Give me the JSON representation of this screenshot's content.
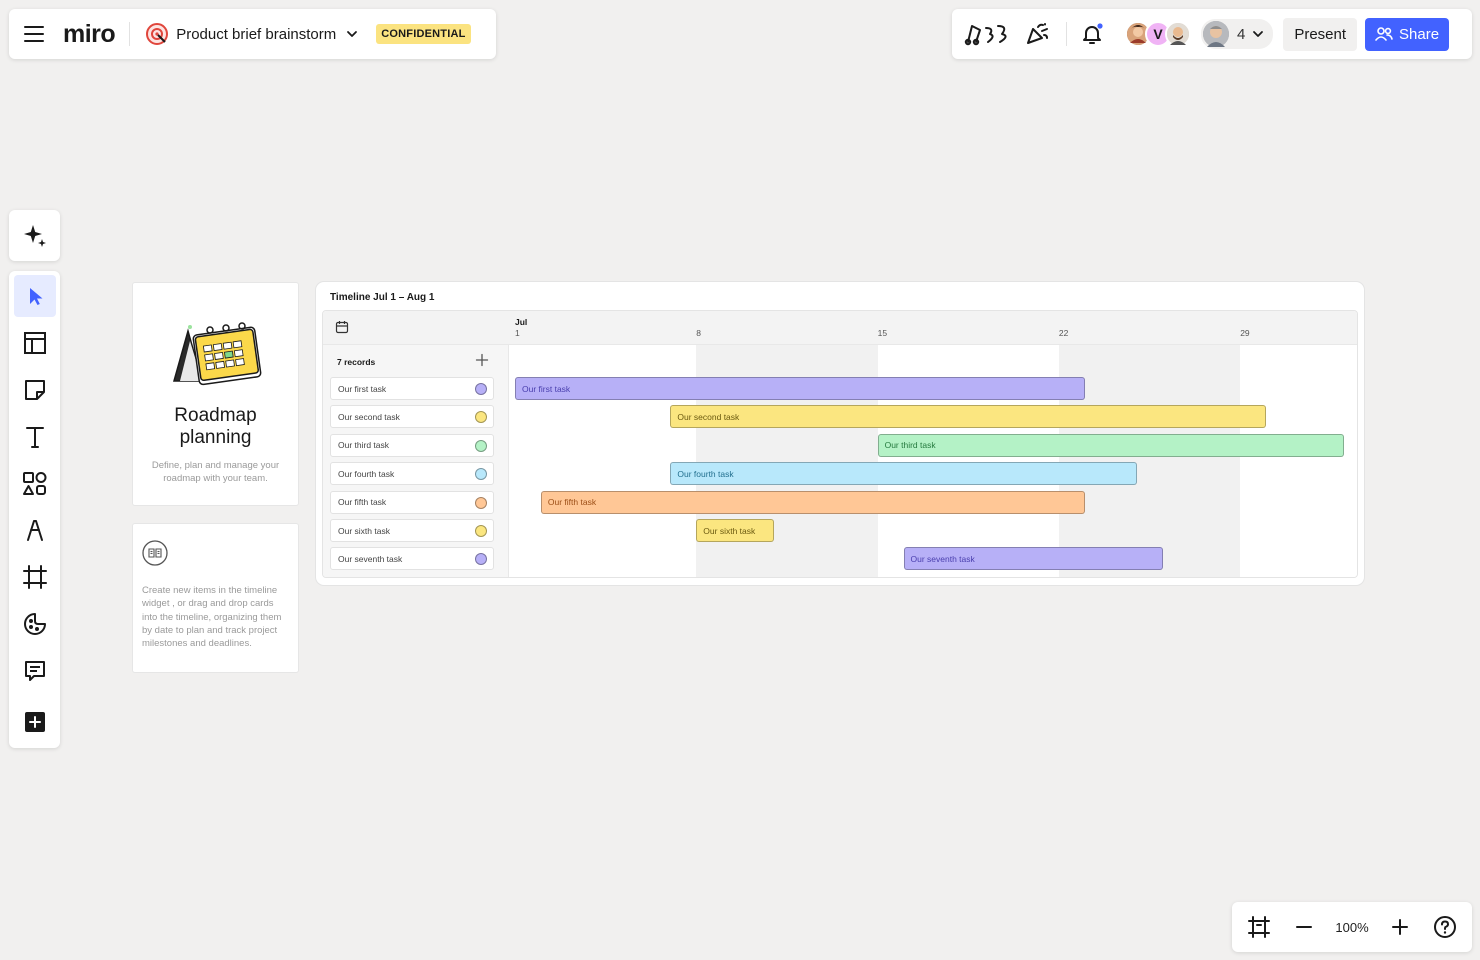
{
  "topbar": {
    "logo": "miro",
    "board_title": "Product brief brainstorm",
    "badge": "CONFIDENTIAL",
    "present_label": "Present",
    "share_label": "Share",
    "collaborator_initial": "V",
    "collaborator_count": "4"
  },
  "colors": {
    "accent": "#4262ff",
    "badge": "#fbe380",
    "selected_tool_bg": "#e6ebff",
    "canvas": "#f1f0ef"
  },
  "toolbar": {
    "ai_icon": "sparkle-icon",
    "tools": [
      {
        "name": "select-tool",
        "icon": "cursor-icon",
        "selected": true
      },
      {
        "name": "templates-tool",
        "icon": "layout-icon"
      },
      {
        "name": "sticky-note-tool",
        "icon": "sticky-note-icon"
      },
      {
        "name": "text-tool",
        "icon": "text-icon"
      },
      {
        "name": "shapes-tool",
        "icon": "shapes-icon"
      },
      {
        "name": "pen-tool",
        "icon": "pen-icon"
      },
      {
        "name": "frame-tool",
        "icon": "frame-icon"
      },
      {
        "name": "stickers-tool",
        "icon": "emoji-icon"
      },
      {
        "name": "comment-tool",
        "icon": "comment-icon"
      },
      {
        "name": "more-tools",
        "icon": "plus-square-icon"
      }
    ]
  },
  "info_card": {
    "heading": "Roadmap planning",
    "description": "Define, plan and manage your roadmap with your team."
  },
  "hint_card": {
    "text": "Create new items in the timeline widget , or drag and drop cards into the timeline, organizing them by date to  plan and track project milestones and deadlines."
  },
  "timeline": {
    "title": "Timeline Jul 1 – Aug 1",
    "month": "Jul",
    "ticks": [
      "1",
      "8",
      "15",
      "22",
      "29"
    ],
    "record_count": "7 records",
    "tasks": [
      {
        "name": "Our first task",
        "color": "#b7b0f7",
        "text": "#4a3fae",
        "start": 0,
        "days": 22
      },
      {
        "name": "Our second task",
        "color": "#fbe680",
        "text": "#6b5a10",
        "start": 6,
        "days": 23
      },
      {
        "name": "Our third task",
        "color": "#b4f2c6",
        "text": "#257a3e",
        "start": 14,
        "days": 18
      },
      {
        "name": "Our fourth task",
        "color": "#b8e8fb",
        "text": "#23708f",
        "start": 6,
        "days": 18
      },
      {
        "name": "Our fifth task",
        "color": "#ffc796",
        "text": "#9c4f17",
        "start": 1,
        "days": 21
      },
      {
        "name": "Our sixth task",
        "color": "#fbe680",
        "text": "#6b5a10",
        "start": 7,
        "days": 3
      },
      {
        "name": "Our seventh task",
        "color": "#b7b0f7",
        "text": "#4a3fae",
        "start": 15,
        "days": 10
      }
    ]
  },
  "zoom": {
    "level": "100%"
  }
}
